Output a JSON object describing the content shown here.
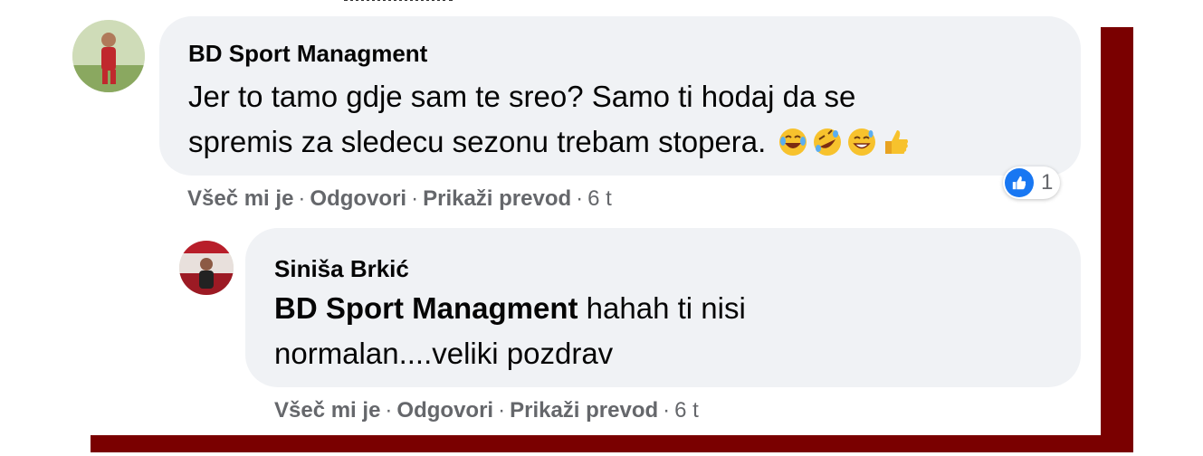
{
  "comments": [
    {
      "author": "BD Sport Managment",
      "text_line1": "Jer to tamo gdje sam te sreo? Samo ti hodaj da se",
      "text_line2": "spremis za sledecu sezonu trebam stopera.",
      "emojis": [
        "tears-of-joy-emoji",
        "rolling-laughing-emoji",
        "grinning-sweat-emoji",
        "thumbs-up-emoji"
      ],
      "reaction_count": "1",
      "actions": {
        "like": "Všeč mi je",
        "reply": "Odgovori",
        "translate": "Prikaži prevod",
        "time": "6 t",
        "separator": "·"
      }
    },
    {
      "author": "Siniša Brkić",
      "mention": "BD Sport Managment",
      "text_line1_rest": " hahah ti nisi",
      "text_line2": "normalan....veliki pozdrav",
      "actions": {
        "like": "Všeč mi je",
        "reply": "Odgovori",
        "translate": "Prikaži prevod",
        "time": "6 t",
        "separator": "·"
      }
    }
  ],
  "colors": {
    "bubble": "#f0f2f5",
    "frame": "#7a0000",
    "meta_text": "#65676b",
    "like_blue": "#1877f2"
  }
}
